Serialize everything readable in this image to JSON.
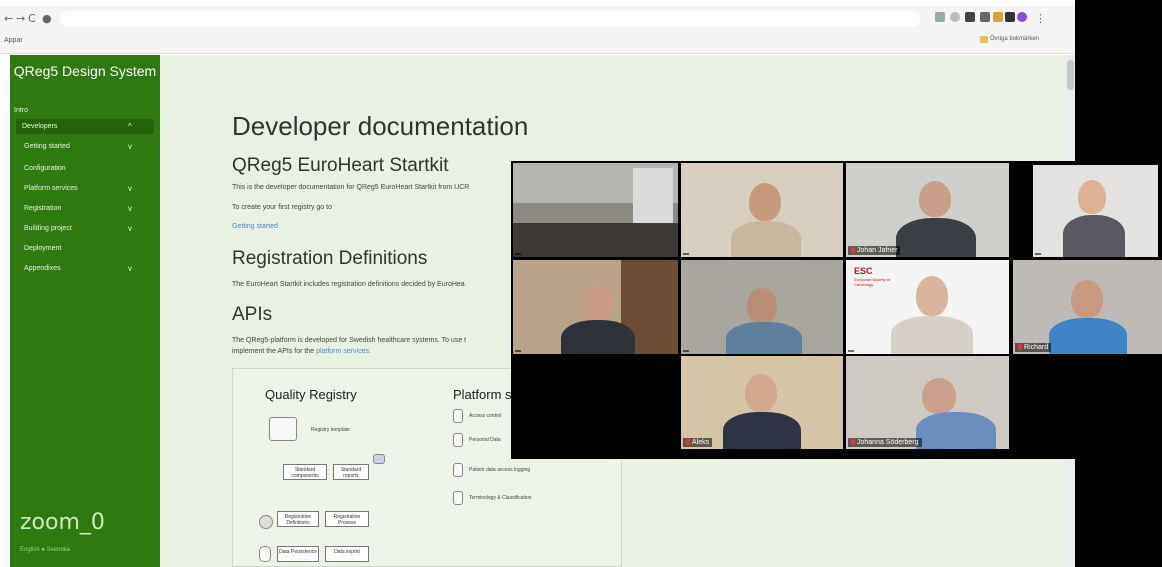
{
  "browser": {
    "apps_label": "Appar",
    "bookmark_folder": "Övriga bokmärken"
  },
  "sidebar": {
    "title": "QReg5 Design System",
    "items": [
      {
        "label": "Intro",
        "chevron": ""
      },
      {
        "label": "Developers",
        "chevron": "^"
      },
      {
        "label": "Getting started",
        "chevron": "v"
      },
      {
        "label": "Configuration",
        "chevron": ""
      },
      {
        "label": "Platform services",
        "chevron": "v"
      },
      {
        "label": "Registration",
        "chevron": "v"
      },
      {
        "label": "Building project",
        "chevron": "v"
      },
      {
        "label": "Deployment",
        "chevron": ""
      },
      {
        "label": "Appendixes",
        "chevron": "v"
      }
    ],
    "overlay_label": "zoom_0",
    "language": "English",
    "language_alt": "Svenska"
  },
  "main": {
    "heading": "Developer documentation",
    "subheading": "QReg5 EuroHeart Startkit",
    "intro_text": "This is the developer documentation for QReg5 EuroHeart Startkit from UCR",
    "create_text": "To create your first registry go to",
    "getting_started_link": "Getting started",
    "registration_heading": "Registration Definitions",
    "registration_text": "The EuroHeart Startkit includes registration definitions decided by EuroHea",
    "apis_heading": "APIs",
    "apis_text_1": "The QReg5-platform is developed for Swedish healthcare systems. To use t",
    "apis_text_2": "implement the APIs for the",
    "platform_services_link": "platform services."
  },
  "diagram": {
    "quality_registry": "Quality Registry",
    "platform_services": "Platform se",
    "registry_template": "Registry template",
    "standard_components": "Standard components",
    "standard_reports": "Standard reports",
    "registration_definitions": "Registration Definitions",
    "registration_process": "Registration Process",
    "data_persistence": "Data Persistence",
    "data_export": "Data export",
    "ps_items": [
      "Access control",
      "Personal Data",
      "Patient data access logging",
      "Terminology & Classification"
    ]
  },
  "gallery": {
    "participants": [
      {
        "name": ""
      },
      {
        "name": ""
      },
      {
        "name": "Johan Jafner"
      },
      {
        "name": ""
      },
      {
        "name": ""
      },
      {
        "name": ""
      },
      {
        "name": ""
      },
      {
        "name": "Richard"
      },
      {
        "name": "Aleks"
      },
      {
        "name": "Johanna Söderberg"
      }
    ],
    "esc_logo": "ESC",
    "esc_sub": "European Society of Cardiology"
  }
}
